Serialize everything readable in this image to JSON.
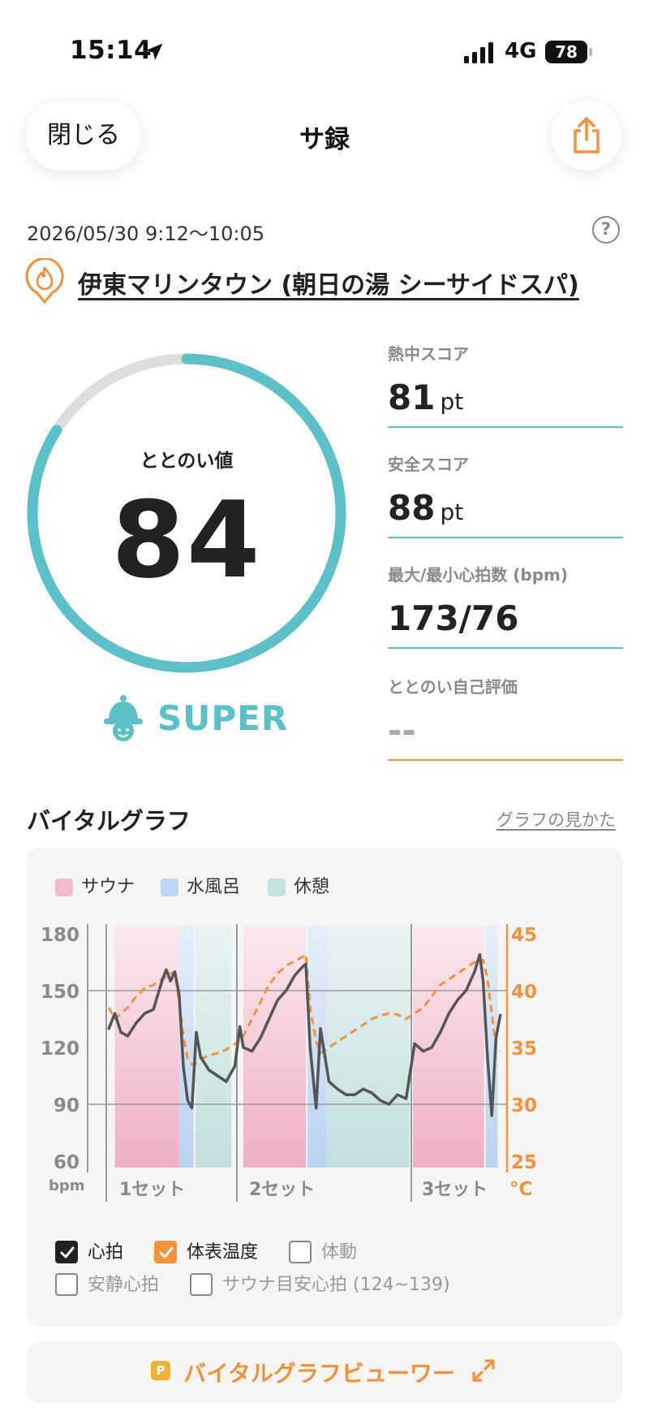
{
  "status_bar": {
    "time": "15:14",
    "network": "4G",
    "battery": "78"
  },
  "header": {
    "close_label": "閉じる",
    "title": "サ録"
  },
  "session": {
    "datetime": "2026/05/30 9:12～10:05",
    "help_label": "?",
    "venue": "伊東マリンタウン (朝日の湯 シーサイドスパ)"
  },
  "totonoi": {
    "label": "ととのい値",
    "value": 84,
    "rank": "SUPER"
  },
  "metrics": [
    {
      "label": "熱中スコア",
      "value": "81",
      "unit": "pt"
    },
    {
      "label": "安全スコア",
      "value": "88",
      "unit": "pt"
    },
    {
      "label": "最大/最小心拍数 (bpm)",
      "value": "173/76",
      "unit": ""
    },
    {
      "label": "ととのい自己評価",
      "value": "--",
      "unit": ""
    }
  ],
  "vitals": {
    "section_title": "バイタルグラフ",
    "guide_link": "グラフの見かた",
    "legend": [
      {
        "label": "サウナ",
        "color": "#f2bccb"
      },
      {
        "label": "水風呂",
        "color": "#bcd6f4"
      },
      {
        "label": "休憩",
        "color": "#c4e2e0"
      }
    ],
    "checkboxes": [
      {
        "label": "心拍",
        "checked": true
      },
      {
        "label": "体表温度",
        "checked": true
      },
      {
        "label": "体動",
        "checked": false
      },
      {
        "label": "安静心拍",
        "checked": false
      },
      {
        "label": "サウナ目安心拍 (124~139)",
        "checked": false
      }
    ],
    "viewer_badge": "P",
    "viewer_label": "バイタルグラフビューワー"
  },
  "chart_data": {
    "type": "line",
    "y_left": {
      "label": "bpm",
      "ticks": [
        180,
        150,
        120,
        90,
        60
      ],
      "range": [
        60,
        180
      ]
    },
    "y_right": {
      "label": "°C",
      "ticks": [
        45,
        40,
        35,
        30,
        25
      ],
      "range": [
        25,
        45
      ]
    },
    "grid": true,
    "set_labels": [
      "1セット",
      "2セット",
      "3セット"
    ],
    "phases": [
      {
        "type": "サウナ",
        "start": 0,
        "end": 7.5
      },
      {
        "type": "水風呂",
        "start": 7.5,
        "end": 9.2
      },
      {
        "type": "休憩",
        "start": 9.4,
        "end": 13.6
      },
      {
        "type": "サウナ",
        "start": 15,
        "end": 22.3
      },
      {
        "type": "水風呂",
        "start": 22.5,
        "end": 24.8
      },
      {
        "type": "休憩",
        "start": 24.8,
        "end": 34.4
      },
      {
        "type": "サウナ",
        "start": 34.8,
        "end": 43.1
      },
      {
        "type": "水風呂",
        "start": 43.3,
        "end": 44.7
      }
    ],
    "x_minutes": [
      -0.7,
      0,
      0.7,
      1.5,
      2.5,
      3.5,
      4.5,
      5.5,
      6,
      6.5,
      7,
      7.5,
      8,
      8.5,
      9,
      9.5,
      10,
      11,
      12,
      13,
      14,
      14.6,
      15,
      16,
      17,
      18,
      19,
      20,
      21,
      22,
      22.3,
      22.8,
      23.5,
      24,
      25,
      26,
      27,
      28,
      29,
      30,
      31,
      32,
      33,
      34,
      35,
      36,
      37,
      38,
      39,
      40,
      41,
      42,
      42.6,
      43,
      43.5,
      44,
      44.5,
      45
    ],
    "series": [
      {
        "name": "心拍",
        "values": [
          130,
          138,
          128,
          126,
          133,
          138,
          140,
          155,
          161,
          155,
          160,
          148,
          110,
          92,
          88,
          128,
          115,
          108,
          105,
          102,
          110,
          131,
          120,
          118,
          125,
          135,
          145,
          150,
          158,
          163,
          164,
          120,
          88,
          130,
          102,
          98,
          95,
          95,
          98,
          96,
          92,
          90,
          95,
          93,
          122,
          118,
          120,
          128,
          138,
          145,
          150,
          160,
          169,
          155,
          115,
          84,
          125,
          137
        ]
      },
      {
        "name": "体表温度",
        "values": [
          38.5,
          37.5,
          38,
          38.5,
          39.5,
          40.2,
          40.5,
          41,
          41.2,
          41.5,
          41.6,
          39,
          36,
          34,
          33.5,
          33.6,
          34,
          34.3,
          34.5,
          34.8,
          35.3,
          35.7,
          36,
          37.5,
          39,
          40.5,
          41.5,
          42.2,
          42.6,
          43,
          43.2,
          38.5,
          35.5,
          34.5,
          35,
          35.5,
          36,
          36.5,
          37,
          37.5,
          37.8,
          38,
          37.9,
          37.5,
          38,
          38.5,
          39.5,
          40.5,
          41,
          41.5,
          42,
          42.5,
          42.5,
          42.7,
          41,
          38,
          35,
          34.6
        ]
      }
    ]
  }
}
